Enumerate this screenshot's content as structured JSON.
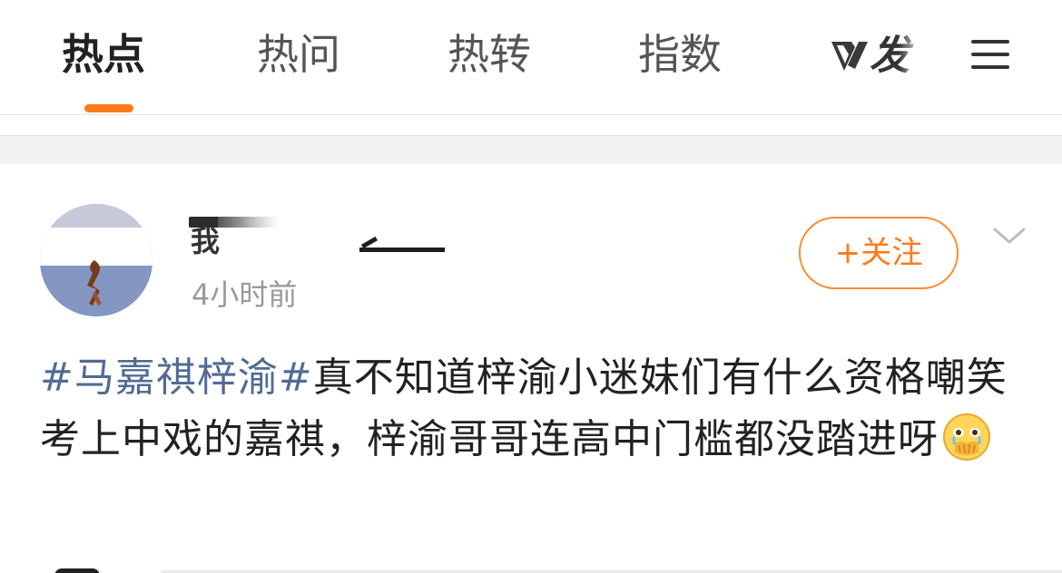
{
  "tabs": [
    {
      "label": "热点",
      "active": true
    },
    {
      "label": "热问",
      "active": false
    },
    {
      "label": "热转",
      "active": false
    },
    {
      "label": "指数",
      "active": false
    }
  ],
  "brand": {
    "text": "发"
  },
  "menu_icon": "hamburger-menu-icon",
  "post": {
    "username": "我",
    "timestamp": "4小时前",
    "follow_label": "+关注",
    "more_icon": "chevron-down-icon",
    "topic": "#马嘉祺梓渝#",
    "body": "真不知道梓渝小迷妹们有什么资格嘲笑考上中戏的嘉祺，梓渝哥哥连高中门槛都没踏进呀",
    "emoji": "crying-face-covering-mouth-emoji"
  },
  "colors": {
    "accent": "#ff7a1a",
    "topic_link": "#516b94",
    "separator": "#f2f2f2"
  }
}
